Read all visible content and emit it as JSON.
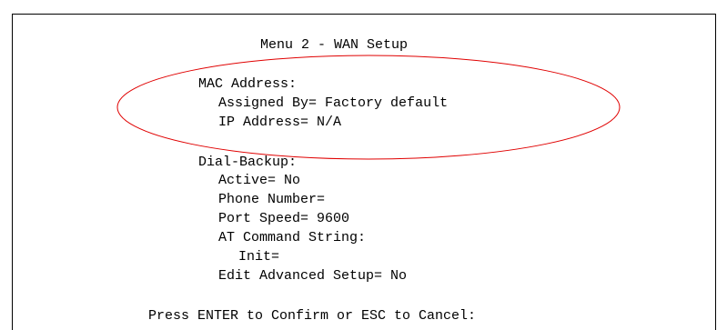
{
  "menu": {
    "title": "Menu 2 - WAN Setup"
  },
  "mac_address": {
    "heading": "MAC Address:",
    "assigned_by_label": "Assigned By=",
    "assigned_by_value": "Factory default",
    "ip_address_label": "IP Address=",
    "ip_address_value": "N/A"
  },
  "dial_backup": {
    "heading": "Dial-Backup:",
    "active_label": "Active=",
    "active_value": "No",
    "phone_number_label": "Phone Number=",
    "phone_number_value": "",
    "port_speed_label": "Port Speed=",
    "port_speed_value": "9600",
    "at_command_heading": "AT Command String:",
    "init_label": "Init=",
    "init_value": "",
    "edit_advanced_label": "Edit Advanced Setup=",
    "edit_advanced_value": "No"
  },
  "footer": {
    "prompt": "Press ENTER to Confirm or ESC to Cancel:"
  },
  "colors": {
    "highlight": "#e00000",
    "text": "#000000",
    "background": "#ffffff"
  }
}
